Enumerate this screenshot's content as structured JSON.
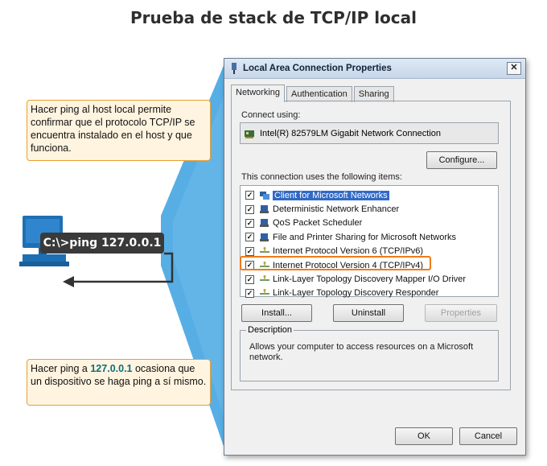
{
  "slide": {
    "title": "Prueba de stack de TCP/IP local",
    "callout_top": "Hacer ping al host local permite confirmar que el protocolo TCP/IP se encuentra instalado en el host y que funciona.",
    "callout_bottom_pre": "Hacer ping a ",
    "callout_bottom_ip": "127.0.0.1",
    "callout_bottom_post": " ocasiona que un dispositivo se haga ping a sí mismo.",
    "command": "C:\\>ping 127.0.0.1",
    "colors": {
      "beam": "#3aa0e0",
      "callout_border": "#e8a030",
      "highlight": "#f07a18",
      "ip_text": "#0a6e7d"
    }
  },
  "dialog": {
    "title": "Local Area Connection Properties",
    "close": "✕",
    "tabs": [
      "Networking",
      "Authentication",
      "Sharing"
    ],
    "active_tab": "Networking",
    "connect_using_label": "Connect using:",
    "adapter": "Intel(R) 82579LM Gigabit Network Connection",
    "configure_button": "Configure...",
    "items_label": "This connection uses the following items:",
    "items": [
      {
        "label": "Client for Microsoft Networks",
        "checked": true,
        "selected": true,
        "icon": "network-client-icon"
      },
      {
        "label": "Deterministic Network Enhancer",
        "checked": true,
        "selected": false,
        "icon": "network-service-icon"
      },
      {
        "label": "QoS Packet Scheduler",
        "checked": true,
        "selected": false,
        "icon": "network-service-icon"
      },
      {
        "label": "File and Printer Sharing for Microsoft Networks",
        "checked": true,
        "selected": false,
        "icon": "network-service-icon"
      },
      {
        "label": "Internet Protocol Version 6 (TCP/IPv6)",
        "checked": true,
        "selected": false,
        "icon": "protocol-icon"
      },
      {
        "label": "Internet Protocol Version 4 (TCP/IPv4)",
        "checked": true,
        "selected": false,
        "icon": "protocol-icon"
      },
      {
        "label": "Link-Layer Topology Discovery Mapper I/O Driver",
        "checked": true,
        "selected": false,
        "icon": "protocol-icon"
      },
      {
        "label": "Link-Layer Topology Discovery Responder",
        "checked": true,
        "selected": false,
        "icon": "protocol-icon"
      }
    ],
    "install_button": "Install...",
    "uninstall_button": "Uninstall",
    "properties_button": "Properties",
    "description_legend": "Description",
    "description_text": "Allows your computer to access resources on a Microsoft network.",
    "ok_button": "OK",
    "cancel_button": "Cancel"
  }
}
